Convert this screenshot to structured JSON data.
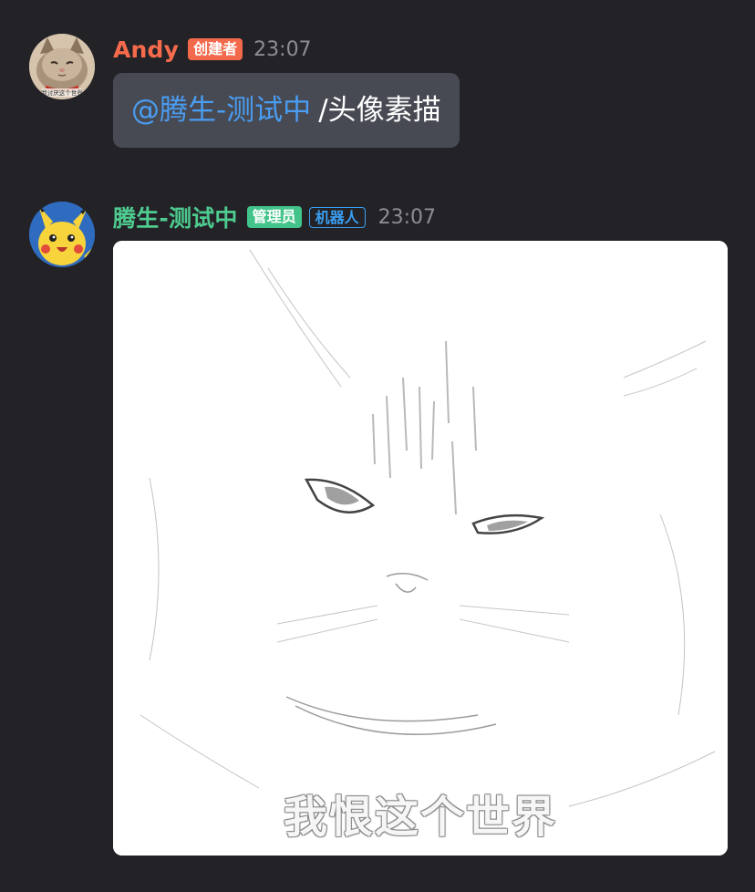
{
  "messages": [
    {
      "sender": "Andy",
      "sender_color": "#f56b4b",
      "badge": {
        "label": "创建者",
        "bg": "#f26a4b",
        "color": "#ffffff"
      },
      "time": "23:07",
      "mention": "@腾生-测试中",
      "text": "/头像素描"
    },
    {
      "sender": "腾生-测试中",
      "sender_color": "#4ecb8f",
      "badges": [
        {
          "label": "管理员",
          "style": "filled",
          "color": "#43c48a"
        },
        {
          "label": "机器人",
          "style": "outline",
          "color": "#3a9ff2"
        }
      ],
      "time": "23:07",
      "image": {
        "subject": "cat pencil sketch",
        "caption": "我恨这个世界"
      }
    }
  ],
  "avatars": {
    "andy": {
      "label": "我讨厌这个世界",
      "icon": "cat-photo-avatar"
    },
    "bot": {
      "icon": "pikachu-avatar"
    }
  }
}
